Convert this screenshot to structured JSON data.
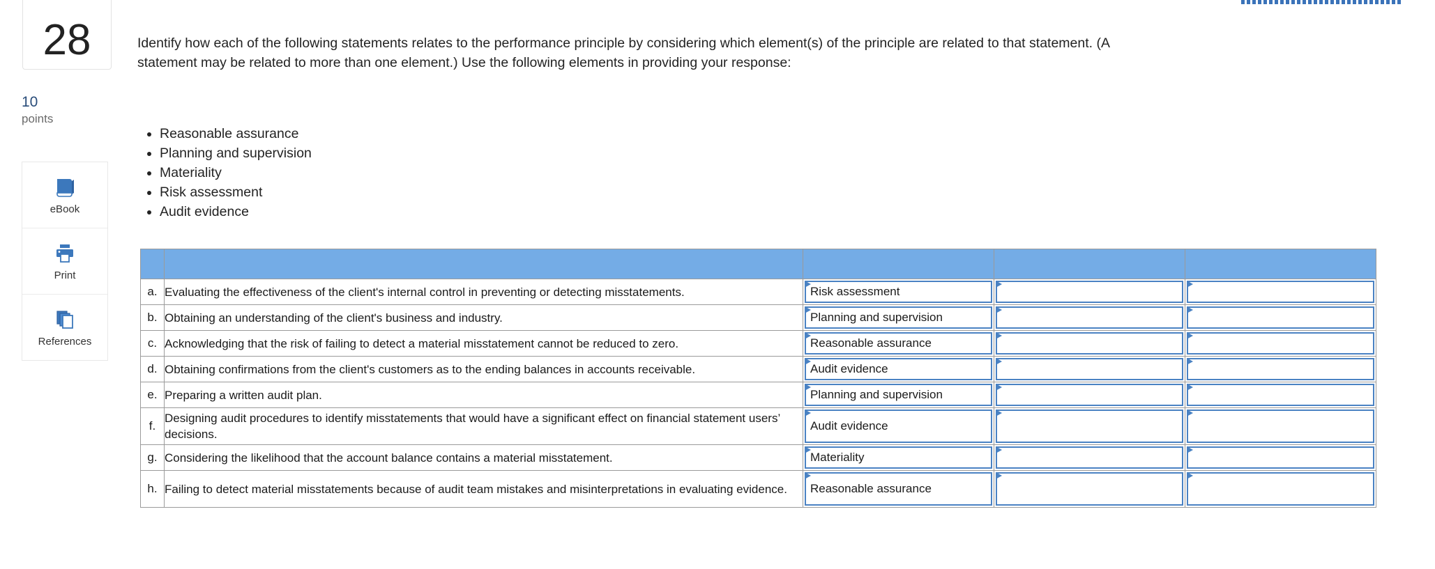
{
  "question": {
    "number": "28",
    "points_value": "10",
    "points_label": "points",
    "prompt": "Identify how each of the following statements relates to the performance principle by considering which element(s) of the principle are related to that statement. (A statement may be related to more than one element.) Use the following elements in providing your response:",
    "elements": [
      "Reasonable assurance",
      "Planning and supervision",
      "Materiality",
      "Risk assessment",
      "Audit evidence"
    ]
  },
  "tools": [
    {
      "label": "eBook",
      "icon": "ebook-icon"
    },
    {
      "label": "Print",
      "icon": "printer-icon"
    },
    {
      "label": "References",
      "icon": "references-icon"
    }
  ],
  "table": {
    "header": [
      "",
      "",
      "",
      "",
      ""
    ],
    "rows": [
      {
        "letter": "a.",
        "statement": "Evaluating the effectiveness of the client's internal control in preventing or detecting misstatements.",
        "answers": [
          "Risk assessment",
          "",
          ""
        ],
        "tall": false
      },
      {
        "letter": "b.",
        "statement": "Obtaining an understanding of the client's business and industry.",
        "answers": [
          "Planning and supervision",
          "",
          ""
        ],
        "tall": false
      },
      {
        "letter": "c.",
        "statement": "Acknowledging that the risk of failing to detect a material misstatement cannot be reduced to zero.",
        "answers": [
          "Reasonable assurance",
          "",
          ""
        ],
        "tall": false
      },
      {
        "letter": "d.",
        "statement": "Obtaining confirmations from the client's customers as to the ending balances in accounts receivable.",
        "answers": [
          "Audit evidence",
          "",
          ""
        ],
        "tall": false
      },
      {
        "letter": "e.",
        "statement": "Preparing a written audit plan.",
        "answers": [
          "Planning and supervision",
          "",
          ""
        ],
        "tall": false
      },
      {
        "letter": "f.",
        "statement": "Designing audit procedures to identify misstatements that would have a significant effect on financial statement users’ decisions.",
        "answers": [
          "Audit evidence",
          "",
          ""
        ],
        "tall": true
      },
      {
        "letter": "g.",
        "statement": "Considering the likelihood that the account balance contains a material misstatement.",
        "answers": [
          "Materiality",
          "",
          ""
        ],
        "tall": false
      },
      {
        "letter": "h.",
        "statement": "Failing to detect material misstatements because of audit team mistakes and misinterpretations in evaluating evidence.",
        "answers": [
          "Reasonable assurance",
          "",
          ""
        ],
        "tall": true
      }
    ]
  },
  "colors": {
    "header_blue": "#74ace6",
    "dropdown_border": "#4a82c3",
    "points_value": "#2a4d7a",
    "accent_dash": "#3b73b9"
  }
}
